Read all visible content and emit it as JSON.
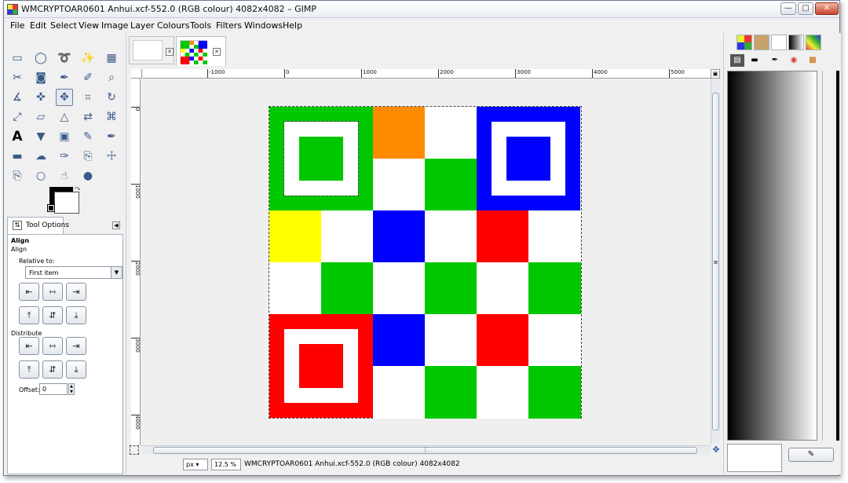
{
  "window": {
    "title": "WMCRYPTOAR0601 Anhui.xcf-552.0 (RGB colour) 4082x4082 – GIMP",
    "minimize_icon": "minimize-icon",
    "maximize_icon": "maximize-icon",
    "close_icon": "close-icon"
  },
  "menubar": [
    "File",
    "Edit",
    "Select",
    "View",
    "Image",
    "Layer",
    "Colours",
    "Tools",
    "Filters",
    "Windows",
    "Help"
  ],
  "toolbox": {
    "tools": [
      "rect-select-icon",
      "ellipse-select-icon",
      "free-select-icon",
      "fuzzy-select-icon",
      "select-by-color-icon",
      "scissors-icon",
      "foreground-select-icon",
      "paths-icon",
      "color-picker-icon",
      "zoom-icon",
      "measure-icon",
      "move-icon",
      "align-icon",
      "crop-icon",
      "rotate-icon",
      "scale-icon",
      "shear-icon",
      "perspective-icon",
      "flip-icon",
      "cage-icon",
      "text-icon",
      "bucket-fill-icon",
      "blend-icon",
      "pencil-icon",
      "paintbrush-icon",
      "eraser-icon",
      "airbrush-icon",
      "ink-icon",
      "clone-icon",
      "heal-icon",
      "perspective-clone-icon",
      "blur-icon",
      "smudge-icon",
      "dodge-burn-icon"
    ],
    "active_tool": "align-icon"
  },
  "tool_options": {
    "tab_label": "Tool Options",
    "section_title": "Align",
    "subtitle": "Align",
    "relative_to_label": "Relative to:",
    "relative_to_value": "First item",
    "distribute_label": "Distribute",
    "offset_label": "Offset:",
    "offset_value": "0"
  },
  "image_tabs": [
    {
      "name": "blank-image"
    },
    {
      "name": "wmcryptoar0601-anhui"
    }
  ],
  "hruler": [
    "-1000",
    "0",
    "1000",
    "2000",
    "3000",
    "4000",
    "5000"
  ],
  "vruler": [
    "0",
    "1000",
    "2000",
    "3000",
    "4000"
  ],
  "image": {
    "grid": [
      [
        "green-finder",
        "green-finder",
        "orange",
        "white",
        "blue-finder",
        "blue-finder"
      ],
      [
        "green-finder",
        "green-finder",
        "white",
        "green",
        "blue-finder",
        "blue-finder"
      ],
      [
        "yellow",
        "white",
        "blue",
        "white",
        "red",
        "white"
      ],
      [
        "white",
        "green",
        "white",
        "green",
        "white",
        "green"
      ],
      [
        "red-finder",
        "red-finder",
        "blue",
        "white",
        "red",
        "white"
      ],
      [
        "red-finder",
        "red-finder",
        "white",
        "green",
        "white",
        "green"
      ]
    ],
    "colors": {
      "green": "#00c800",
      "orange": "#ff8c00",
      "blue": "#0000ff",
      "red": "#ff0000",
      "yellow": "#ffff00",
      "white": "#ffffff"
    }
  },
  "statusbar": {
    "unit": "px",
    "zoom": "12.5 %",
    "status_text": "WMCRYPTOAR0601 Anhui.xcf-552.0 (RGB colour) 4082x4082"
  }
}
